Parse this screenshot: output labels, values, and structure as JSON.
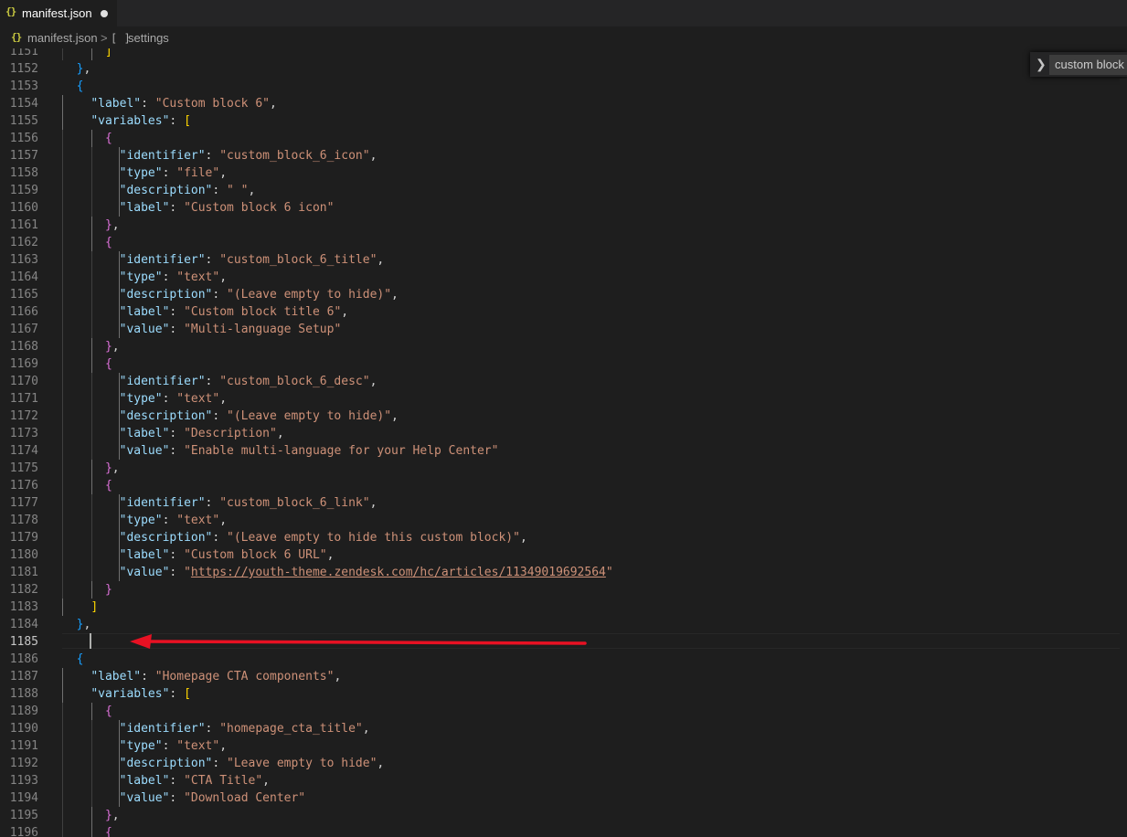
{
  "tab": {
    "icon": "{}",
    "filename": "manifest.json",
    "modified": true
  },
  "breadcrumb": {
    "icon": "{}",
    "file": "manifest.json",
    "separator": ">",
    "array_icon": "[ ]",
    "node": "settings"
  },
  "find_widget": {
    "toggle_icon": "chevron-right-icon",
    "query": "custom block"
  },
  "colors": {
    "key": "#9cdcfe",
    "string": "#ce9178",
    "bracket1": "#179fff",
    "bracket2": "#da70d6",
    "bracket3": "#ffd700",
    "annotation_arrow": "#e81123"
  },
  "editor": {
    "active_line": 1185,
    "lines": [
      {
        "n": "1151",
        "lvl": 3,
        "tokens": [
          {
            "t": "]",
            "c": "b3"
          }
        ]
      },
      {
        "n": "1152",
        "lvl": 1,
        "tokens": [
          {
            "t": "}",
            "c": "b1"
          },
          {
            "t": ",",
            "c": "p"
          }
        ]
      },
      {
        "n": "1153",
        "lvl": 1,
        "tokens": [
          {
            "t": "{",
            "c": "b1"
          }
        ]
      },
      {
        "n": "1154",
        "lvl": 2,
        "tokens": [
          {
            "t": "\"label\"",
            "c": "key"
          },
          {
            "t": ": ",
            "c": "p"
          },
          {
            "t": "\"Custom block 6\"",
            "c": "str"
          },
          {
            "t": ",",
            "c": "p"
          }
        ]
      },
      {
        "n": "1155",
        "lvl": 2,
        "tokens": [
          {
            "t": "\"variables\"",
            "c": "key"
          },
          {
            "t": ": ",
            "c": "p"
          },
          {
            "t": "[",
            "c": "b3"
          }
        ]
      },
      {
        "n": "1156",
        "lvl": 3,
        "tokens": [
          {
            "t": "{",
            "c": "b2"
          }
        ]
      },
      {
        "n": "1157",
        "lvl": 4,
        "tokens": [
          {
            "t": "\"identifier\"",
            "c": "key"
          },
          {
            "t": ": ",
            "c": "p"
          },
          {
            "t": "\"custom_block_6_icon\"",
            "c": "str"
          },
          {
            "t": ",",
            "c": "p"
          }
        ]
      },
      {
        "n": "1158",
        "lvl": 4,
        "tokens": [
          {
            "t": "\"type\"",
            "c": "key"
          },
          {
            "t": ": ",
            "c": "p"
          },
          {
            "t": "\"file\"",
            "c": "str"
          },
          {
            "t": ",",
            "c": "p"
          }
        ]
      },
      {
        "n": "1159",
        "lvl": 4,
        "tokens": [
          {
            "t": "\"description\"",
            "c": "key"
          },
          {
            "t": ": ",
            "c": "p"
          },
          {
            "t": "\" \"",
            "c": "str"
          },
          {
            "t": ",",
            "c": "p"
          }
        ]
      },
      {
        "n": "1160",
        "lvl": 4,
        "tokens": [
          {
            "t": "\"label\"",
            "c": "key"
          },
          {
            "t": ": ",
            "c": "p"
          },
          {
            "t": "\"Custom block 6 icon\"",
            "c": "str"
          }
        ]
      },
      {
        "n": "1161",
        "lvl": 3,
        "tokens": [
          {
            "t": "}",
            "c": "b2"
          },
          {
            "t": ",",
            "c": "p"
          }
        ]
      },
      {
        "n": "1162",
        "lvl": 3,
        "tokens": [
          {
            "t": "{",
            "c": "b2"
          }
        ]
      },
      {
        "n": "1163",
        "lvl": 4,
        "tokens": [
          {
            "t": "\"identifier\"",
            "c": "key"
          },
          {
            "t": ": ",
            "c": "p"
          },
          {
            "t": "\"custom_block_6_title\"",
            "c": "str"
          },
          {
            "t": ",",
            "c": "p"
          }
        ]
      },
      {
        "n": "1164",
        "lvl": 4,
        "tokens": [
          {
            "t": "\"type\"",
            "c": "key"
          },
          {
            "t": ": ",
            "c": "p"
          },
          {
            "t": "\"text\"",
            "c": "str"
          },
          {
            "t": ",",
            "c": "p"
          }
        ]
      },
      {
        "n": "1165",
        "lvl": 4,
        "tokens": [
          {
            "t": "\"description\"",
            "c": "key"
          },
          {
            "t": ": ",
            "c": "p"
          },
          {
            "t": "\"(Leave empty to hide)\"",
            "c": "str"
          },
          {
            "t": ",",
            "c": "p"
          }
        ]
      },
      {
        "n": "1166",
        "lvl": 4,
        "tokens": [
          {
            "t": "\"label\"",
            "c": "key"
          },
          {
            "t": ": ",
            "c": "p"
          },
          {
            "t": "\"Custom block title 6\"",
            "c": "str"
          },
          {
            "t": ",",
            "c": "p"
          }
        ]
      },
      {
        "n": "1167",
        "lvl": 4,
        "tokens": [
          {
            "t": "\"value\"",
            "c": "key"
          },
          {
            "t": ": ",
            "c": "p"
          },
          {
            "t": "\"Multi-language Setup\"",
            "c": "str"
          }
        ]
      },
      {
        "n": "1168",
        "lvl": 3,
        "tokens": [
          {
            "t": "}",
            "c": "b2"
          },
          {
            "t": ",",
            "c": "p"
          }
        ]
      },
      {
        "n": "1169",
        "lvl": 3,
        "tokens": [
          {
            "t": "{",
            "c": "b2"
          }
        ]
      },
      {
        "n": "1170",
        "lvl": 4,
        "tokens": [
          {
            "t": "\"identifier\"",
            "c": "key"
          },
          {
            "t": ": ",
            "c": "p"
          },
          {
            "t": "\"custom_block_6_desc\"",
            "c": "str"
          },
          {
            "t": ",",
            "c": "p"
          }
        ]
      },
      {
        "n": "1171",
        "lvl": 4,
        "tokens": [
          {
            "t": "\"type\"",
            "c": "key"
          },
          {
            "t": ": ",
            "c": "p"
          },
          {
            "t": "\"text\"",
            "c": "str"
          },
          {
            "t": ",",
            "c": "p"
          }
        ]
      },
      {
        "n": "1172",
        "lvl": 4,
        "tokens": [
          {
            "t": "\"description\"",
            "c": "key"
          },
          {
            "t": ": ",
            "c": "p"
          },
          {
            "t": "\"(Leave empty to hide)\"",
            "c": "str"
          },
          {
            "t": ",",
            "c": "p"
          }
        ]
      },
      {
        "n": "1173",
        "lvl": 4,
        "tokens": [
          {
            "t": "\"label\"",
            "c": "key"
          },
          {
            "t": ": ",
            "c": "p"
          },
          {
            "t": "\"Description\"",
            "c": "str"
          },
          {
            "t": ",",
            "c": "p"
          }
        ]
      },
      {
        "n": "1174",
        "lvl": 4,
        "tokens": [
          {
            "t": "\"value\"",
            "c": "key"
          },
          {
            "t": ": ",
            "c": "p"
          },
          {
            "t": "\"Enable multi-language for your Help Center\"",
            "c": "str"
          }
        ]
      },
      {
        "n": "1175",
        "lvl": 3,
        "tokens": [
          {
            "t": "}",
            "c": "b2"
          },
          {
            "t": ",",
            "c": "p"
          }
        ]
      },
      {
        "n": "1176",
        "lvl": 3,
        "tokens": [
          {
            "t": "{",
            "c": "b2"
          }
        ]
      },
      {
        "n": "1177",
        "lvl": 4,
        "tokens": [
          {
            "t": "\"identifier\"",
            "c": "key"
          },
          {
            "t": ": ",
            "c": "p"
          },
          {
            "t": "\"custom_block_6_link\"",
            "c": "str"
          },
          {
            "t": ",",
            "c": "p"
          }
        ]
      },
      {
        "n": "1178",
        "lvl": 4,
        "tokens": [
          {
            "t": "\"type\"",
            "c": "key"
          },
          {
            "t": ": ",
            "c": "p"
          },
          {
            "t": "\"text\"",
            "c": "str"
          },
          {
            "t": ",",
            "c": "p"
          }
        ]
      },
      {
        "n": "1179",
        "lvl": 4,
        "tokens": [
          {
            "t": "\"description\"",
            "c": "key"
          },
          {
            "t": ": ",
            "c": "p"
          },
          {
            "t": "\"(Leave empty to hide this custom block)\"",
            "c": "str"
          },
          {
            "t": ",",
            "c": "p"
          }
        ]
      },
      {
        "n": "1180",
        "lvl": 4,
        "tokens": [
          {
            "t": "\"label\"",
            "c": "key"
          },
          {
            "t": ": ",
            "c": "p"
          },
          {
            "t": "\"Custom block 6 URL\"",
            "c": "str"
          },
          {
            "t": ",",
            "c": "p"
          }
        ]
      },
      {
        "n": "1181",
        "lvl": 4,
        "tokens": [
          {
            "t": "\"value\"",
            "c": "key"
          },
          {
            "t": ": ",
            "c": "p"
          },
          {
            "t": "\"",
            "c": "str"
          },
          {
            "t": "https://youth-theme.zendesk.com/hc/articles/11349019692564",
            "c": "url"
          },
          {
            "t": "\"",
            "c": "str"
          }
        ]
      },
      {
        "n": "1182",
        "lvl": 3,
        "tokens": [
          {
            "t": "}",
            "c": "b2"
          }
        ]
      },
      {
        "n": "1183",
        "lvl": 2,
        "tokens": [
          {
            "t": "]",
            "c": "b3"
          }
        ]
      },
      {
        "n": "1184",
        "lvl": 1,
        "tokens": [
          {
            "t": "}",
            "c": "b1"
          },
          {
            "t": ",",
            "c": "p"
          }
        ]
      },
      {
        "n": "1185",
        "lvl": 1,
        "tokens": []
      },
      {
        "n": "1186",
        "lvl": 1,
        "tokens": [
          {
            "t": "{",
            "c": "b1"
          }
        ]
      },
      {
        "n": "1187",
        "lvl": 2,
        "tokens": [
          {
            "t": "\"label\"",
            "c": "key"
          },
          {
            "t": ": ",
            "c": "p"
          },
          {
            "t": "\"Homepage CTA components\"",
            "c": "str"
          },
          {
            "t": ",",
            "c": "p"
          }
        ]
      },
      {
        "n": "1188",
        "lvl": 2,
        "tokens": [
          {
            "t": "\"variables\"",
            "c": "key"
          },
          {
            "t": ": ",
            "c": "p"
          },
          {
            "t": "[",
            "c": "b3"
          }
        ]
      },
      {
        "n": "1189",
        "lvl": 3,
        "tokens": [
          {
            "t": "{",
            "c": "b2"
          }
        ]
      },
      {
        "n": "1190",
        "lvl": 4,
        "tokens": [
          {
            "t": "\"identifier\"",
            "c": "key"
          },
          {
            "t": ": ",
            "c": "p"
          },
          {
            "t": "\"homepage_cta_title\"",
            "c": "str"
          },
          {
            "t": ",",
            "c": "p"
          }
        ]
      },
      {
        "n": "1191",
        "lvl": 4,
        "tokens": [
          {
            "t": "\"type\"",
            "c": "key"
          },
          {
            "t": ": ",
            "c": "p"
          },
          {
            "t": "\"text\"",
            "c": "str"
          },
          {
            "t": ",",
            "c": "p"
          }
        ]
      },
      {
        "n": "1192",
        "lvl": 4,
        "tokens": [
          {
            "t": "\"description\"",
            "c": "key"
          },
          {
            "t": ": ",
            "c": "p"
          },
          {
            "t": "\"Leave empty to hide\"",
            "c": "str"
          },
          {
            "t": ",",
            "c": "p"
          }
        ]
      },
      {
        "n": "1193",
        "lvl": 4,
        "tokens": [
          {
            "t": "\"label\"",
            "c": "key"
          },
          {
            "t": ": ",
            "c": "p"
          },
          {
            "t": "\"CTA Title\"",
            "c": "str"
          },
          {
            "t": ",",
            "c": "p"
          }
        ]
      },
      {
        "n": "1194",
        "lvl": 4,
        "tokens": [
          {
            "t": "\"value\"",
            "c": "key"
          },
          {
            "t": ": ",
            "c": "p"
          },
          {
            "t": "\"Download Center\"",
            "c": "str"
          }
        ]
      },
      {
        "n": "1195",
        "lvl": 3,
        "tokens": [
          {
            "t": "}",
            "c": "b2"
          },
          {
            "t": ",",
            "c": "p"
          }
        ]
      },
      {
        "n": "1196",
        "lvl": 3,
        "tokens": [
          {
            "t": "{",
            "c": "b2"
          }
        ]
      }
    ]
  }
}
